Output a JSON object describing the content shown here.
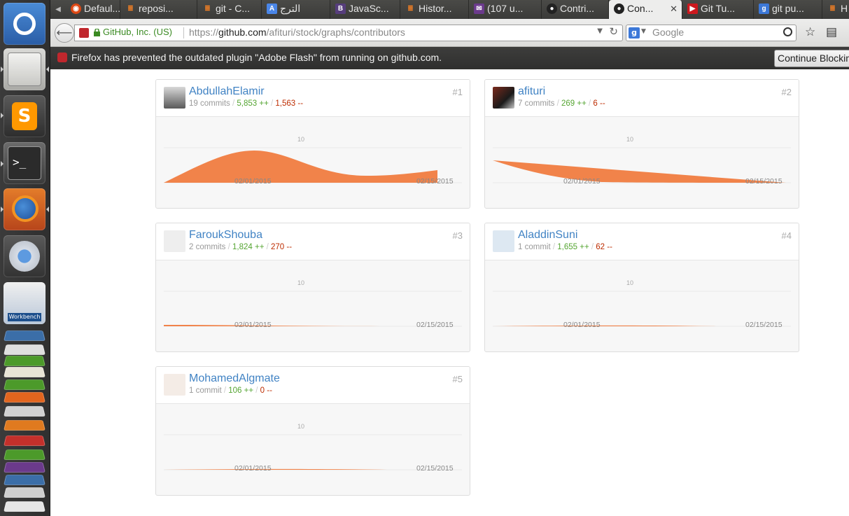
{
  "browser": {
    "tabs": [
      {
        "label": "Defaul...",
        "icon": "ubuntu-icon"
      },
      {
        "label": "reposi...",
        "icon": "stackoverflow-icon"
      },
      {
        "label": "git - C...",
        "icon": "stackoverflow-icon"
      },
      {
        "label": "الترج",
        "icon": "translate-icon"
      },
      {
        "label": "JavaSc...",
        "icon": "bootstrap-icon"
      },
      {
        "label": "Histor...",
        "icon": "stackoverflow-icon"
      },
      {
        "label": "(107 u...",
        "icon": "mail-icon"
      },
      {
        "label": "Contri...",
        "icon": "github-icon"
      },
      {
        "label": "Con...",
        "icon": "github-icon",
        "active": true
      },
      {
        "label": "Git Tu...",
        "icon": "youtube-icon"
      },
      {
        "label": "git pu...",
        "icon": "google-icon"
      },
      {
        "label": "H",
        "icon": "stackoverflow-icon"
      }
    ],
    "tab_close": "✕",
    "identity": "GitHub, Inc. (US)",
    "url_prefix": "https://",
    "url_host": "github.com",
    "url_path": "/afituri/stock/graphs/contributors",
    "search_placeholder": "Google"
  },
  "notification": {
    "message": "Firefox has prevented the outdated plugin \"Adobe Flash\" from running on github.com.",
    "button": "Continue Blocking"
  },
  "chart_axis": {
    "x_tick_1": "02/01/2015",
    "x_tick_2": "02/15/2015",
    "y_tick": "10"
  },
  "contributors": [
    {
      "name": "AbdullahElamir",
      "commits": "19 commits",
      "additions": "5,853 ++",
      "deletions": "1,563 --",
      "rank": "#1"
    },
    {
      "name": "afituri",
      "commits": "7 commits",
      "additions": "269 ++",
      "deletions": "6 --",
      "rank": "#2"
    },
    {
      "name": "FaroukShouba",
      "commits": "2 commits",
      "additions": "1,824 ++",
      "deletions": "270 --",
      "rank": "#3"
    },
    {
      "name": "AladdinSuni",
      "commits": "1 commit",
      "additions": "1,655 ++",
      "deletions": "62 --",
      "rank": "#4"
    },
    {
      "name": "MohamedAlgmate",
      "commits": "1 commit",
      "additions": "106 ++",
      "deletions": "0 --",
      "rank": "#5"
    }
  ],
  "colors": {
    "accent_orange": "#f1834a",
    "link_blue": "#4183c4",
    "add_green": "#55a532",
    "del_red": "#bd2c00"
  }
}
